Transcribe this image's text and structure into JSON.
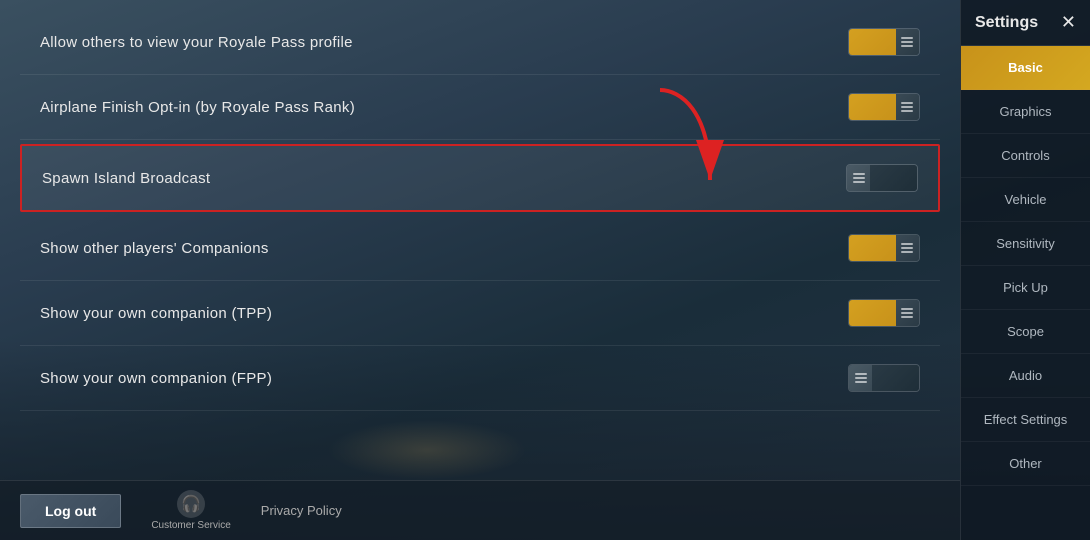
{
  "background": {
    "color": "#2a3a4a"
  },
  "settings": {
    "title": "Settings",
    "close_label": "✕",
    "rows": [
      {
        "id": "royale-pass-profile",
        "label": "Allow others to view your Royale Pass profile",
        "toggle_state": "on",
        "highlighted": false
      },
      {
        "id": "airplane-finish",
        "label": "Airplane Finish Opt-in (by Royale Pass Rank)",
        "toggle_state": "on",
        "highlighted": false
      },
      {
        "id": "spawn-island-broadcast",
        "label": "Spawn Island Broadcast",
        "toggle_state": "off",
        "highlighted": true
      },
      {
        "id": "show-companions",
        "label": "Show other players' Companions",
        "toggle_state": "on",
        "highlighted": false
      },
      {
        "id": "own-companion-tpp",
        "label": "Show your own companion (TPP)",
        "toggle_state": "on",
        "highlighted": false
      },
      {
        "id": "own-companion-fpp",
        "label": "Show your own companion (FPP)",
        "toggle_state": "off",
        "highlighted": false
      }
    ]
  },
  "bottom_bar": {
    "logout_label": "Log out",
    "customer_service_icon": "🎧",
    "customer_service_label": "Customer Service",
    "privacy_policy_label": "Privacy Policy"
  },
  "sidebar": {
    "title": "Settings",
    "close_icon": "✕",
    "nav_items": [
      {
        "id": "basic",
        "label": "Basic",
        "active": true
      },
      {
        "id": "graphics",
        "label": "Graphics",
        "active": false
      },
      {
        "id": "controls",
        "label": "Controls",
        "active": false
      },
      {
        "id": "vehicle",
        "label": "Vehicle",
        "active": false
      },
      {
        "id": "sensitivity",
        "label": "Sensitivity",
        "active": false
      },
      {
        "id": "pick-up",
        "label": "Pick Up",
        "active": false
      },
      {
        "id": "scope",
        "label": "Scope",
        "active": false
      },
      {
        "id": "audio",
        "label": "Audio",
        "active": false
      },
      {
        "id": "effect-settings",
        "label": "Effect Settings",
        "active": false
      },
      {
        "id": "other",
        "label": "Other",
        "active": false
      }
    ]
  }
}
